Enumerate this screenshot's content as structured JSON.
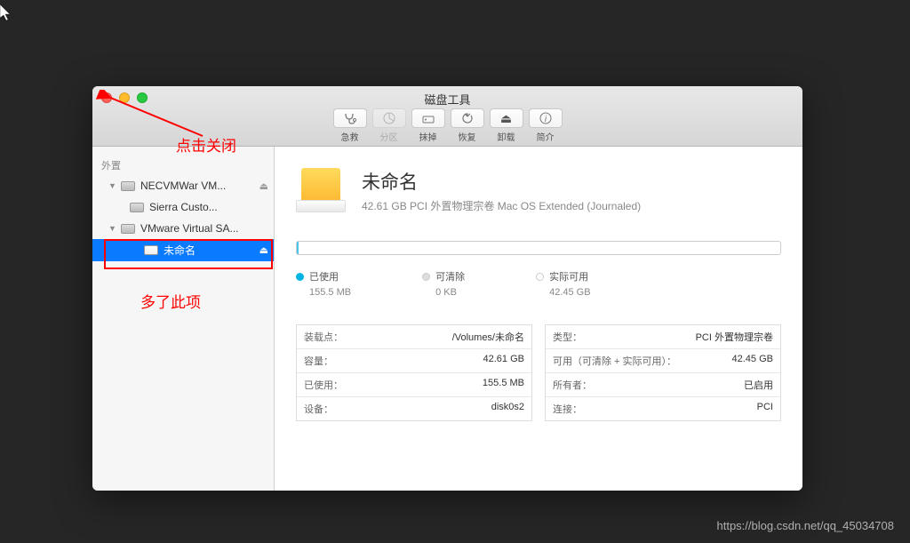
{
  "window": {
    "title": "磁盘工具"
  },
  "toolbar": {
    "first_aid": "急救",
    "partition": "分区",
    "erase": "抹掉",
    "restore": "恢复",
    "unmount": "卸载",
    "info": "简介"
  },
  "sidebar": {
    "external_header": "外置",
    "items": [
      {
        "label": "NECVMWar VM...",
        "eject": true
      },
      {
        "label": "Sierra Custo..."
      },
      {
        "label": "VMware Virtual SA..."
      },
      {
        "label": "未命名",
        "eject": true,
        "selected": true
      }
    ]
  },
  "volume": {
    "name": "未命名",
    "desc": "42.61 GB PCI 外置物理宗卷 Mac OS Extended (Journaled)"
  },
  "legend": {
    "used_label": "已使用",
    "used_value": "155.5 MB",
    "purgeable_label": "可清除",
    "purgeable_value": "0 KB",
    "free_label": "实际可用",
    "free_value": "42.45 GB"
  },
  "props_left": [
    {
      "k": "装载点：",
      "v": "/Volumes/未命名"
    },
    {
      "k": "容量：",
      "v": "42.61 GB"
    },
    {
      "k": "已使用：",
      "v": "155.5 MB"
    },
    {
      "k": "设备：",
      "v": "disk0s2"
    }
  ],
  "props_right": [
    {
      "k": "类型：",
      "v": "PCI 外置物理宗卷"
    },
    {
      "k": "可用（可清除 + 实际可用）：",
      "v": "42.45 GB"
    },
    {
      "k": "所有者：",
      "v": "已启用"
    },
    {
      "k": "连接：",
      "v": "PCI"
    }
  ],
  "annotations": {
    "close_hint": "点击关闭",
    "added_item": "多了此项"
  },
  "watermark": "https://blog.csdn.net/qq_45034708"
}
